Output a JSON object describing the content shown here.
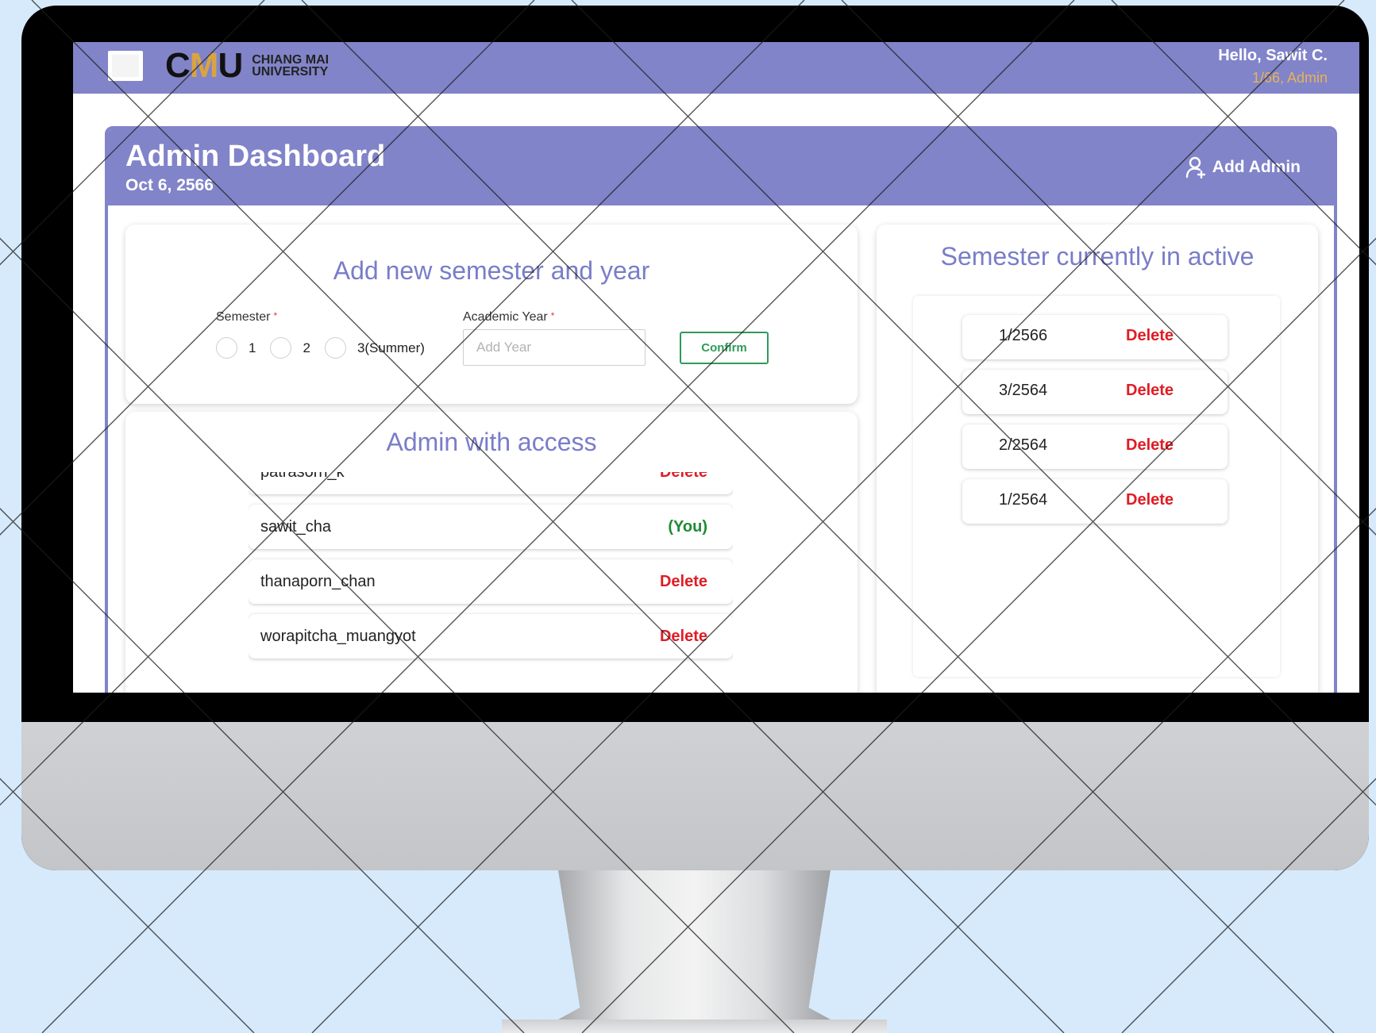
{
  "header": {
    "logo_mark_left": "C",
    "logo_mark_mid": "M",
    "logo_mark_right": "U",
    "logo_line1": "CHIANG MAI",
    "logo_line2": "UNIVERSITY",
    "greeting": "Hello, Sawit C.",
    "role": "1/66, Admin"
  },
  "dashboard": {
    "title": "Admin Dashboard",
    "date": "Oct 6, 2566",
    "add_admin_label": "Add Admin"
  },
  "add_semester": {
    "title": "Add new semester and year",
    "semester_label": "Semester",
    "required_mark": "*",
    "semester_options": [
      "1",
      "2",
      "3(Summer)"
    ],
    "year_label": "Academic Year",
    "year_placeholder": "Add Year",
    "confirm_label": "Confirm"
  },
  "admins": {
    "title": "Admin with access",
    "rows": [
      {
        "name": "patrasorn_k",
        "action": "Delete"
      },
      {
        "name": "sawit_cha",
        "action": "(You)"
      },
      {
        "name": "thanaporn_chan",
        "action": "Delete"
      },
      {
        "name": "worapitcha_muangyot",
        "action": "Delete"
      }
    ]
  },
  "active_semesters": {
    "title": "Semester currently in active",
    "rows": [
      {
        "value": "1/2566",
        "action": "Delete"
      },
      {
        "value": "3/2564",
        "action": "Delete"
      },
      {
        "value": "2/2564",
        "action": "Delete"
      },
      {
        "value": "1/2564",
        "action": "Delete"
      }
    ]
  },
  "colors": {
    "primary": "#8184c9",
    "title_text": "#7a7dc8",
    "delete": "#e01c24",
    "you": "#1e8a35",
    "confirm": "#2e9b5a",
    "role_text": "#e7b25b",
    "background": "#d6eafb"
  }
}
